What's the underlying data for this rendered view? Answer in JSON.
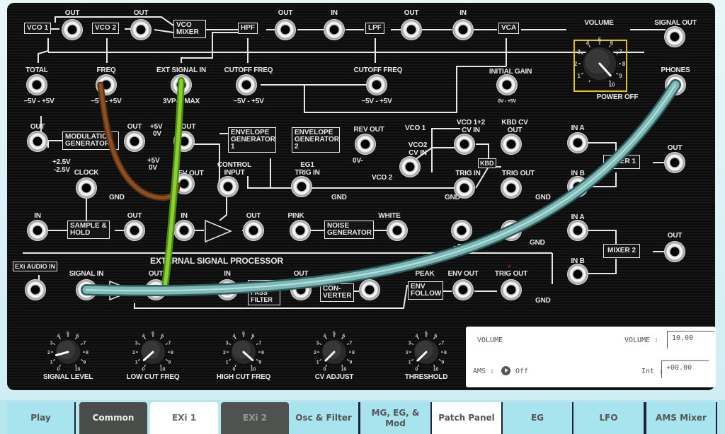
{
  "panel": {
    "modules": {
      "vco1": "VCO 1",
      "vco2": "VCO 2",
      "vco_mixer": "VCO MIXER",
      "hpf": "HPF",
      "lpf": "LPF",
      "vca_top": "VCA",
      "modulation_generator": "MODULATION GENERATOR",
      "envelope_generator_1": "ENVELOPE GENERATOR 1",
      "envelope_generator_2": "ENVELOPE GENERATOR 2",
      "sample_hold": "SAMPLE & HOLD",
      "vca_mid": "VCA",
      "noise_generator": "NOISE GENERATOR",
      "kbd": "KBD",
      "mixer1": "MIXER 1",
      "mixer2": "MIXER 2",
      "exi_audio_in": "EXi AUDIO IN",
      "amp": "AMP",
      "band_pass_filter": "BAND PASS FILTER",
      "converter": "CON- VERTER",
      "env_follow": "ENV FOLLOW"
    },
    "labels": {
      "vco1_out": "OUT",
      "vco2_out": "OUT",
      "hpf_out": "OUT",
      "lpf_in": "IN",
      "lpf_out": "OUT",
      "vca_in": "IN",
      "volume": "VOLUME",
      "signal_out": "SIGNAL OUT",
      "total": "TOTAL",
      "total_range": "−5V - +5V",
      "freq": "FREQ",
      "freq_range": "−5V - +5V",
      "ext_signal_in": "EXT SIGNAL IN",
      "ext_range": "3VP-P MAX",
      "cutoff_freq_hpf": "CUTOFF FREQ",
      "cutoff_hpf_range": "−5V - +5V",
      "cutoff_freq_lpf": "CUTOFF FREQ",
      "cutoff_lpf_range": "−5V - +5V",
      "initial_gain": "INITIAL GAIN",
      "initial_gain_range": "0V - +5V",
      "power_off": "POWER OFF",
      "phones": "PHONES",
      "mg_out1": "OUT",
      "mg_range1a": "+2.5V",
      "mg_range1b": "-2.5V",
      "mg_out2": "OUT",
      "mg_range2a": "+5V",
      "mg_range2b": "0V",
      "eg1_out": "OUT",
      "eg1_range_a": "+5V",
      "eg1_range_b": "0V",
      "eg1_rev_out": "REV OUT",
      "control_input": "CONTROL INPUT",
      "rev_out": "REV OUT",
      "rev_range": "0V-",
      "eg1_trig_in": "EG1 TRIG IN",
      "gnd1": "GND",
      "vco1_cv": "VCO 1",
      "vco2_cv_in": "VCO2 CV IN",
      "vco2_cv": "VCO 2",
      "vco12_cv_in": "VCO 1+2 CV IN",
      "kbd_cv_out": "KBD CV OUT",
      "trig_in": "TRIG IN",
      "trig_out": "TRIG OUT",
      "gnd2": "GND",
      "gnd3": "GND",
      "clock": "CLOCK",
      "gnd_clock": "GND",
      "sh_in": "IN",
      "sh_out": "OUT",
      "vca_mid_in": "IN",
      "vca_mid_out": "OUT",
      "pink": "PINK",
      "white": "WHITE",
      "wheel_range": "−5V - +5V",
      "gnd_wheel": "GND",
      "mixer1_in_a": "IN A",
      "mixer1_in_b": "IN B",
      "mixer1_out": "OUT",
      "mixer2_in_a": "IN A",
      "mixer2_in_b": "IN B",
      "mixer2_out": "OUT",
      "esp_title": "EXTERNAL SIGNAL PROCESSOR",
      "signal_in": "SIGNAL IN",
      "amp_out": "OUT",
      "bpf_in": "IN",
      "bpf_out": "OUT",
      "conv_out": "CV OUT",
      "peak": "PEAK",
      "env_out": "ENV OUT",
      "esp_trig_out": "TRIG OUT",
      "gnd_esp": "GND"
    },
    "knobs": [
      {
        "label": "SIGNAL LEVEL",
        "value": 1.5
      },
      {
        "label": "LOW CUT FREQ",
        "value": 0.6
      },
      {
        "label": "HIGH CUT FREQ",
        "value": 9.4
      },
      {
        "label": "CV ADJUST",
        "value": 0.5
      },
      {
        "label": "THRESHOLD",
        "value": 0.5
      }
    ],
    "volume_knob": {
      "value": 9.6,
      "scale": [
        "1",
        "2",
        "3",
        "4",
        "5",
        "6",
        "7",
        "8",
        "9",
        "10"
      ]
    },
    "cables": [
      {
        "name": "brown",
        "color": "#7a4418",
        "from": "FREQ",
        "to": "REV OUT"
      },
      {
        "name": "green",
        "color": "#7cc22a",
        "from": "EXT SIGNAL IN",
        "to": "AMP OUT"
      },
      {
        "name": "cyan",
        "color": "#6fa8a8",
        "from": "PHONES",
        "to": "SIGNAL IN"
      }
    ]
  },
  "info": {
    "title": "VOLUME",
    "volume_label": "VOLUME :",
    "volume_value": "10.00",
    "ams_label": "AMS :",
    "ams_value": "Off",
    "int_label": "Int :",
    "int_value": "+00.00"
  },
  "tabs": [
    {
      "label": "Play"
    },
    {
      "label": "Common"
    },
    {
      "label": "EXi 1"
    },
    {
      "label": "EXi 2"
    },
    {
      "label": "Osc & Filter"
    },
    {
      "label": "MG, EG, & Mod"
    },
    {
      "label": "Patch Panel"
    },
    {
      "label": "EG"
    },
    {
      "label": "LFO"
    },
    {
      "label": "AMS Mixer"
    }
  ]
}
